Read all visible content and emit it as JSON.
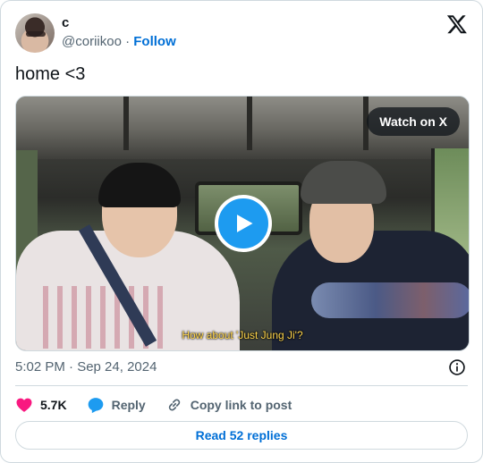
{
  "author": {
    "display_name": "c",
    "handle": "@coriikoo",
    "separator": "·",
    "follow_label": "Follow"
  },
  "tweet": {
    "text": "home <3"
  },
  "media": {
    "watch_label": "Watch on X",
    "subtitle": "How about 'Just Jung Ji'?"
  },
  "meta": {
    "timestamp": "5:02 PM · Sep 24, 2024"
  },
  "actions": {
    "like_count": "5.7K",
    "reply_label": "Reply",
    "copy_link_label": "Copy link to post"
  },
  "read_replies_label": "Read 52 replies",
  "colors": {
    "like": "#f91880",
    "reply": "#1d9bf0",
    "link": "#006fd6",
    "muted": "#536471",
    "border": "#cfd9de"
  },
  "icons": [
    "x-logo-icon",
    "play-icon",
    "info-icon",
    "heart-icon",
    "reply-bubble-icon",
    "link-icon"
  ]
}
